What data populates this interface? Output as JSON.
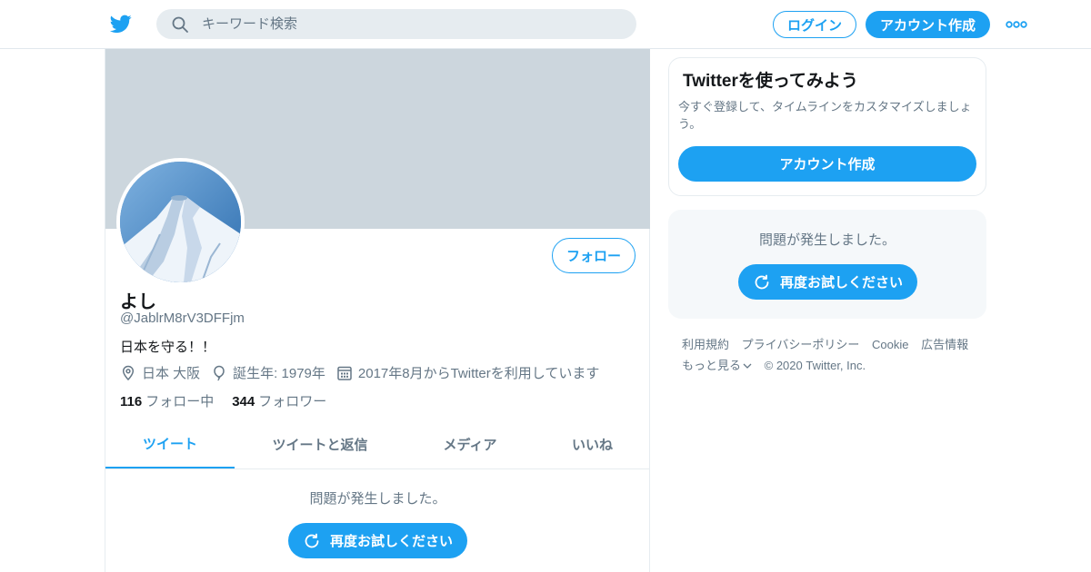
{
  "header": {
    "search_placeholder": "キーワード検索",
    "login_label": "ログイン",
    "signup_label": "アカウント作成",
    "brand_color": "#1DA1F2"
  },
  "profile": {
    "name": "よし",
    "handle": "@JablrM8rV3DFFjm",
    "bio": "日本を守る！！",
    "location": "日本 大阪",
    "birthday": "誕生年: 1979年",
    "joined": "2017年8月からTwitterを利用しています",
    "following_count": "116",
    "following_label": "フォロー中",
    "followers_count": "344",
    "followers_label": "フォロワー",
    "follow_button": "フォロー"
  },
  "tabs": [
    {
      "label": "ツイート",
      "active": true
    },
    {
      "label": "ツイートと返信",
      "active": false
    },
    {
      "label": "メディア",
      "active": false
    },
    {
      "label": "いいね",
      "active": false
    }
  ],
  "timeline": {
    "error_text": "問題が発生しました。",
    "retry_label": "再度お試しください"
  },
  "sidebar": {
    "signup_card": {
      "title": "Twitterを使ってみよう",
      "description": "今すぐ登録して、タイムラインをカスタマイズしましょう。",
      "button": "アカウント作成"
    },
    "error_card": {
      "error_text": "問題が発生しました。",
      "retry_label": "再度お試しください"
    },
    "footer": {
      "links": [
        "利用規約",
        "プライバシーポリシー",
        "Cookie",
        "広告情報"
      ],
      "more": "もっと見る",
      "copyright": "© 2020 Twitter, Inc."
    }
  }
}
